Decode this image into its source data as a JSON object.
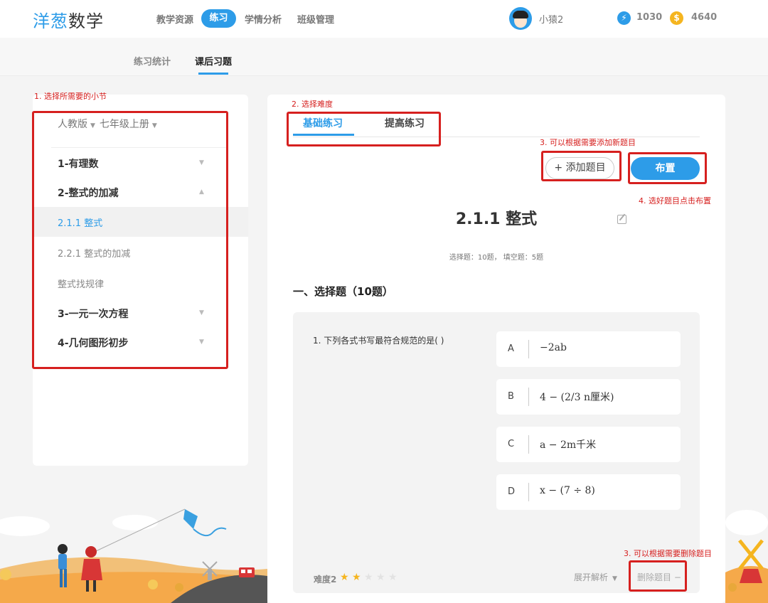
{
  "header": {
    "logo_part1": "洋葱",
    "logo_part2": "数学",
    "nav": [
      "教学资源",
      "练习",
      "学情分析",
      "班级管理"
    ],
    "user_name": "小猿2",
    "points": "1030",
    "coins": "4640",
    "points_icon": "⚡",
    "coins_icon": "$"
  },
  "subnav": {
    "tabs": [
      "练习统计",
      "课后习题"
    ]
  },
  "annotations": {
    "step1": "1. 选择所需要的小节",
    "step2": "2. 选择难度",
    "step3_add": "3. 可以根据需要添加新题目",
    "step4": "4. 选好题目点击布置",
    "step3_delete": "3. 可以根据需要删除题目"
  },
  "sidebar": {
    "edition": "人教版",
    "grade": "七年级上册",
    "chapters": [
      "1-有理数",
      "2-整式的加减",
      "3-一元一次方程",
      "4-几何图形初步"
    ],
    "sections": [
      "2.1.1 整式",
      "2.2.1 整式的加减",
      "整式找规律"
    ]
  },
  "main": {
    "difficulty_tabs": [
      "基础练习",
      "提高练习"
    ],
    "add_button": "+ 添加题目",
    "assign_button": "布置",
    "title": "2.1.1 整式",
    "counts": "选择题：10题， 填空题：5题",
    "section_title": "一、选择题（10题）",
    "question": {
      "stem": "1.  下列各式书写最符合规范的是(   )",
      "options": [
        {
          "letter": "A",
          "text": "−2ab"
        },
        {
          "letter": "B",
          "text": "4 − (2/3 n厘米)"
        },
        {
          "letter": "C",
          "text": "a − 2m千米"
        },
        {
          "letter": "D",
          "text": "x − (7 ÷ 8)"
        }
      ],
      "difficulty_label": "难度2",
      "stars_filled": 2,
      "stars_total": 5,
      "expand_label": "展开解析",
      "delete_label": "删除题目 −"
    }
  },
  "colors": {
    "accent": "#2d9ce8",
    "annotation": "#d6201f",
    "star": "#f5b51f"
  }
}
